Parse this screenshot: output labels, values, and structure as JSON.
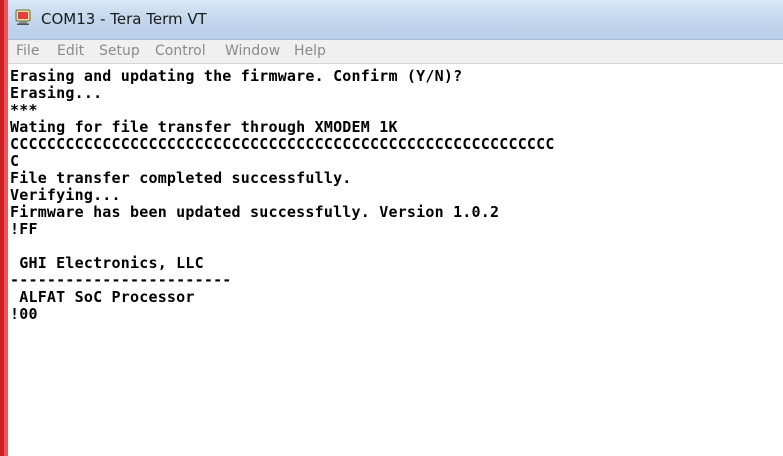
{
  "window": {
    "title": "COM13 - Tera Term VT"
  },
  "menu": [
    "File",
    "Edit",
    "Setup",
    "Control",
    "Window",
    "Help"
  ],
  "terminal": {
    "lines": [
      "Erasing and updating the firmware. Confirm (Y/N)?",
      "Erasing...",
      "***",
      "Wating for file transfer through XMODEM 1K",
      "CCCCCCCCCCCCCCCCCCCCCCCCCCCCCCCCCCCCCCCCCCCCCCCCCCCCCCCCCCC",
      "C",
      "File transfer completed successfully.",
      "Verifying...",
      "Firmware has been updated successfully. Version 1.0.2",
      "!FF",
      "",
      " GHI Electronics, LLC",
      "------------------------",
      " ALFAT SoC Processor",
      "!00"
    ]
  },
  "colors": {
    "title_gradient_top": "#dbe8f6",
    "title_gradient_bottom": "#b9cfe8",
    "menubar_bg": "#f0f0f0",
    "menu_text": "#8a8a8a",
    "terminal_bg": "#ffffff",
    "terminal_text": "#000000",
    "window_edge": "#cc1f26"
  },
  "icons": {
    "app_icon": "tera-term-icon"
  }
}
